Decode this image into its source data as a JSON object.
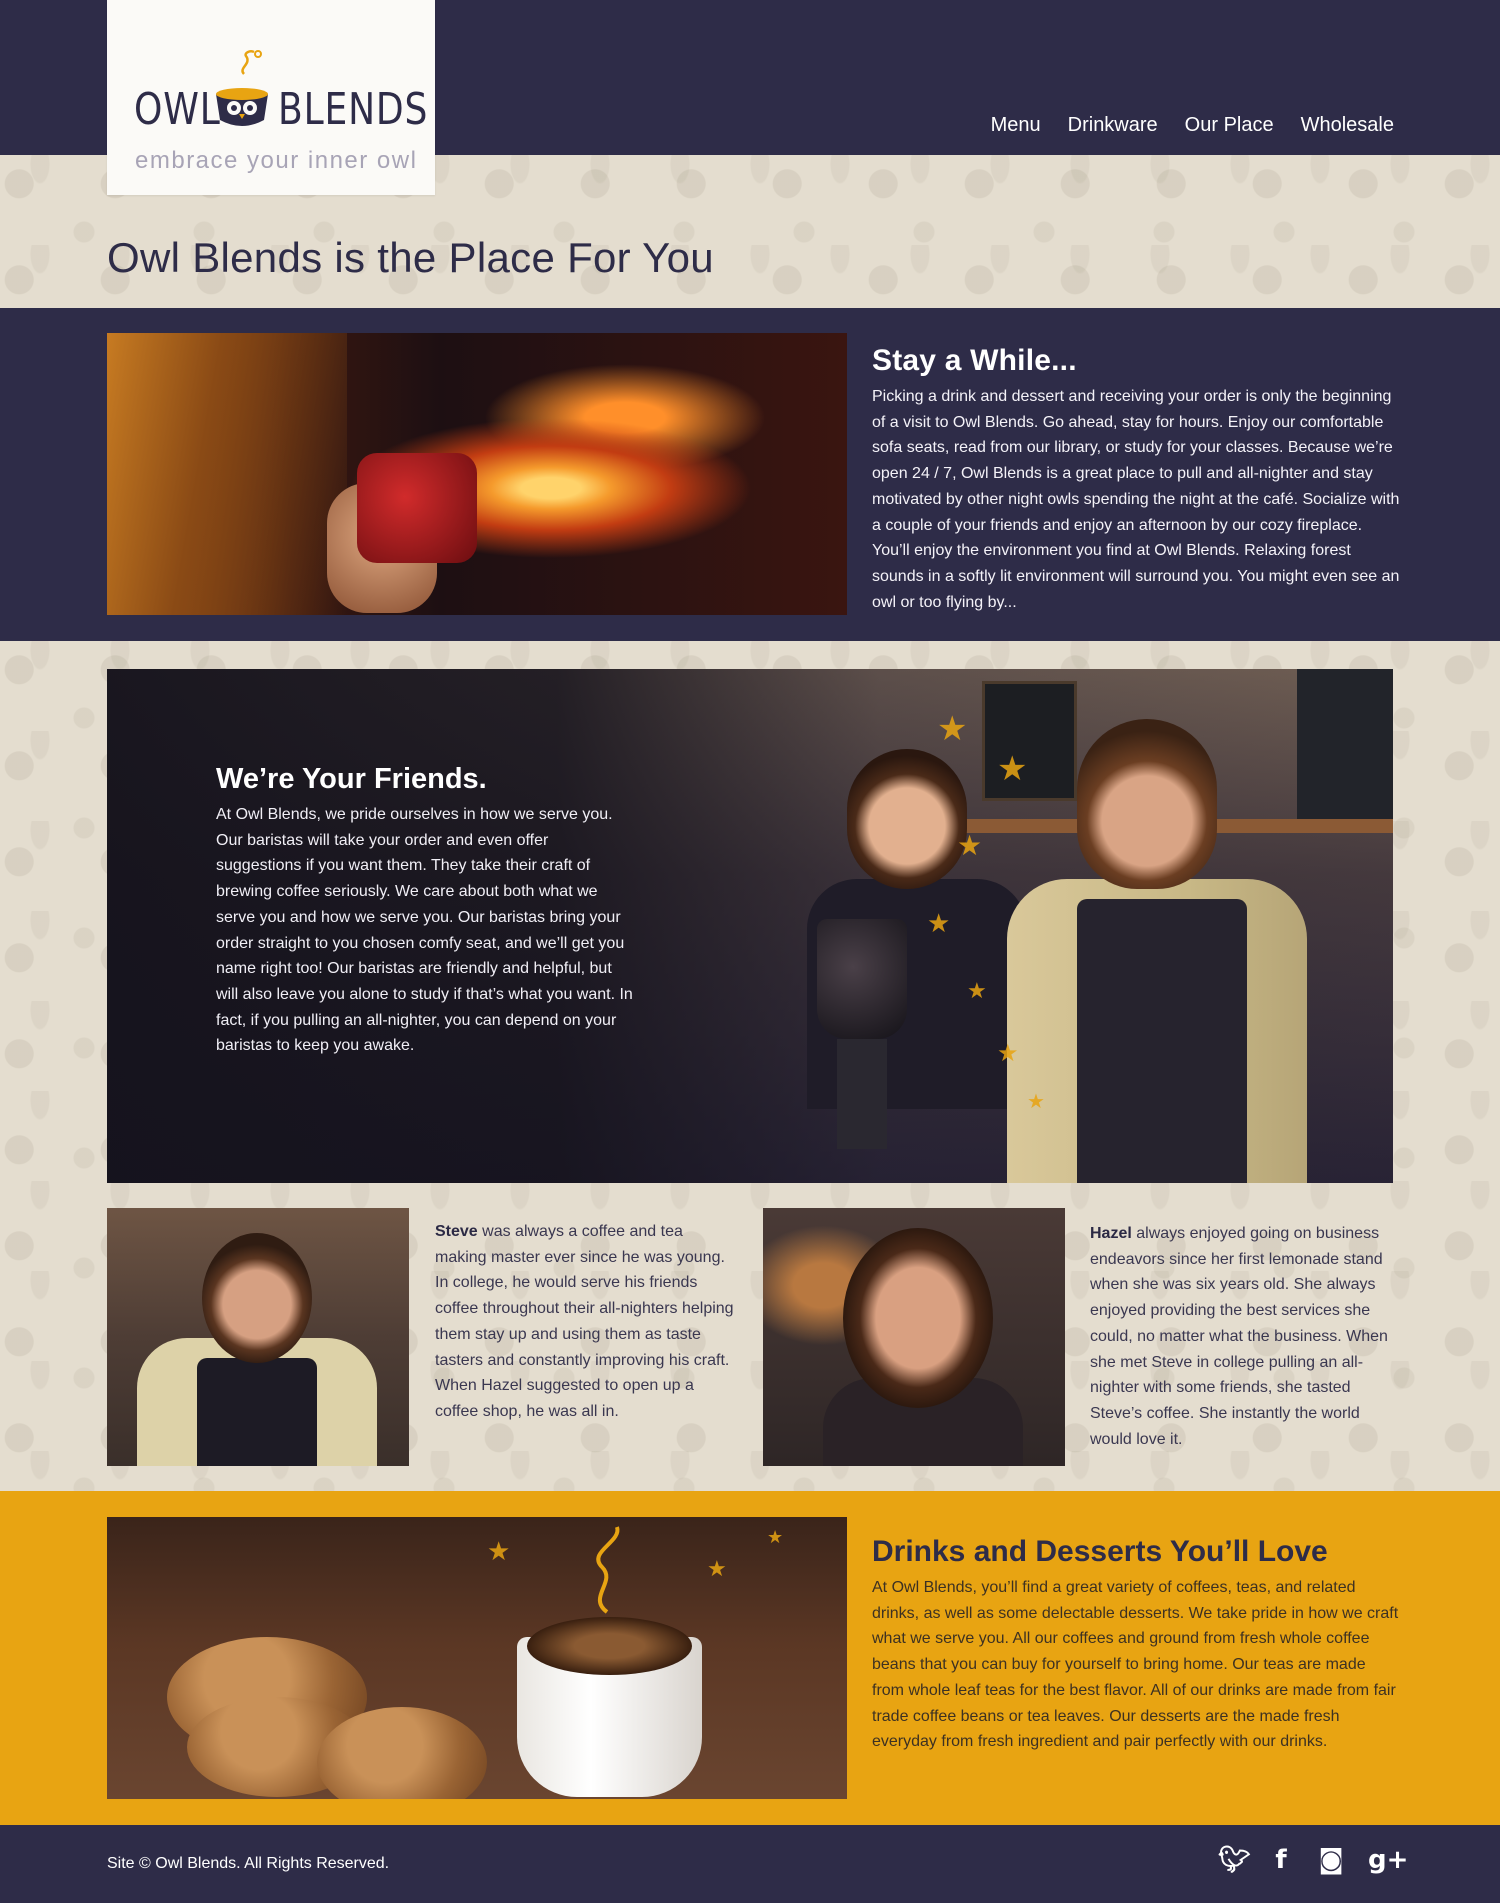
{
  "brand": {
    "logo_left": "OWL",
    "logo_right": "BLENDS",
    "tagline": "embrace your inner owl",
    "colors": {
      "navy": "#2e2c48",
      "gold": "#e8a412",
      "cream": "#e4ddcf"
    }
  },
  "nav": {
    "items": [
      {
        "label": "Menu"
      },
      {
        "label": "Drinkware"
      },
      {
        "label": "Our Place"
      },
      {
        "label": "Wholesale"
      }
    ]
  },
  "page": {
    "title": "Owl Blends is the Place For You"
  },
  "stay": {
    "heading": "Stay a While...",
    "body": "Picking a drink and dessert and receiving your order is only the beginning of a visit to Owl Blends. Go ahead, stay for hours. Enjoy our comfortable sofa seats, read from our library, or study for your classes. Because we’re open 24 / 7, Owl Blends is a great place to pull and all-nighter and stay motivated by other night owls spending the night at the café. Socialize with a couple of your friends and enjoy an afternoon by our cozy fireplace. You’ll enjoy the environment you find at Owl Blends. Relaxing forest sounds in a softly lit environment will surround you. You might even see an owl or too flying by..."
  },
  "friends": {
    "heading": "We’re Your Friends.",
    "body": "At Owl Blends, we pride ourselves in how we serve you. Our baristas will take your order and even offer suggestions if you want them. They take their craft of brewing coffee seriously. We care about both what we serve you and how we serve you. Our baristas bring your order straight to you chosen comfy seat, and we’ll get you name right too! Our baristas are friendly and helpful, but will also leave you alone to study if that’s what you want. In fact, if you pulling an all-nighter, you can depend on your baristas to keep you awake."
  },
  "bios": {
    "steve": {
      "name": "Steve",
      "body": " was always a coffee and tea making master ever since he was young. In college, he would serve his friends coffee throughout their all-nighters helping them stay up and using them as taste tasters and constantly improving his craft. When Hazel suggested to open up a coffee shop, he was all in."
    },
    "hazel": {
      "name": "Hazel",
      "body": " always enjoyed going on business endeavors since her first lemonade stand when she was six years old. She always enjoyed providing the best services she could, no matter what the business. When she met Steve in college pulling an all-nighter with some friends, she tasted Steve’s coffee. She instantly the world would love it."
    }
  },
  "drinks": {
    "heading": "Drinks and Desserts You’ll Love",
    "body": "At Owl Blends, you’ll find a great variety of coffees, teas, and related drinks, as well as some delectable desserts. We take pride in how we craft what we serve you. All our coffees and ground from fresh whole coffee beans that you can buy for yourself to bring home. Our teas are made from whole leaf teas for the best flavor. All of our drinks are made from fair trade coffee beans or tea leaves. Our desserts are the made fresh everyday from fresh ingredient and pair perfectly with our drinks."
  },
  "footer": {
    "copyright": "Site © Owl Blends. All Rights Reserved.",
    "social": [
      {
        "icon": "twitter-icon",
        "glyph": "🐦︎"
      },
      {
        "icon": "facebook-icon",
        "glyph": "f"
      },
      {
        "icon": "instagram-icon",
        "glyph": "◙"
      },
      {
        "icon": "google-plus-icon",
        "glyph": "g+"
      }
    ]
  }
}
